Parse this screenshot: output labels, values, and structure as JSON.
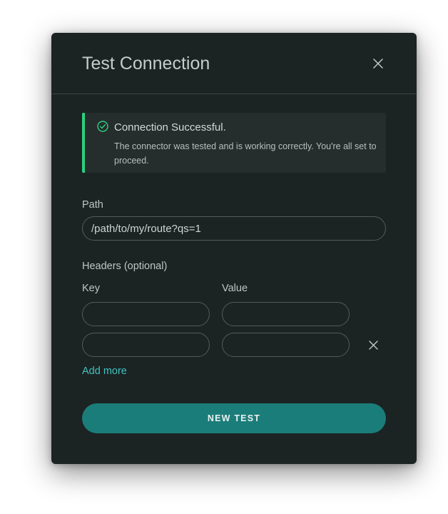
{
  "modal": {
    "title": "Test Connection"
  },
  "alert": {
    "title": "Connection Successful.",
    "message": "The connector was tested and is working correctly. You're all set to proceed."
  },
  "path": {
    "label": "Path",
    "value": "/path/to/my/route?qs=1"
  },
  "headers": {
    "label": "Headers (optional)",
    "key_label": "Key",
    "value_label": "Value",
    "rows": [
      {
        "key": "",
        "value": ""
      },
      {
        "key": "",
        "value": ""
      }
    ],
    "add_more_label": "Add more"
  },
  "actions": {
    "new_test_label": "NEW TEST"
  },
  "colors": {
    "modal_bg": "#1c2323",
    "success": "#2bd17e",
    "accent": "#3fc3bf",
    "button": "#1b7d79"
  },
  "icons": {
    "close": "close-icon",
    "success": "check-circle-icon",
    "remove_row": "close-icon"
  }
}
